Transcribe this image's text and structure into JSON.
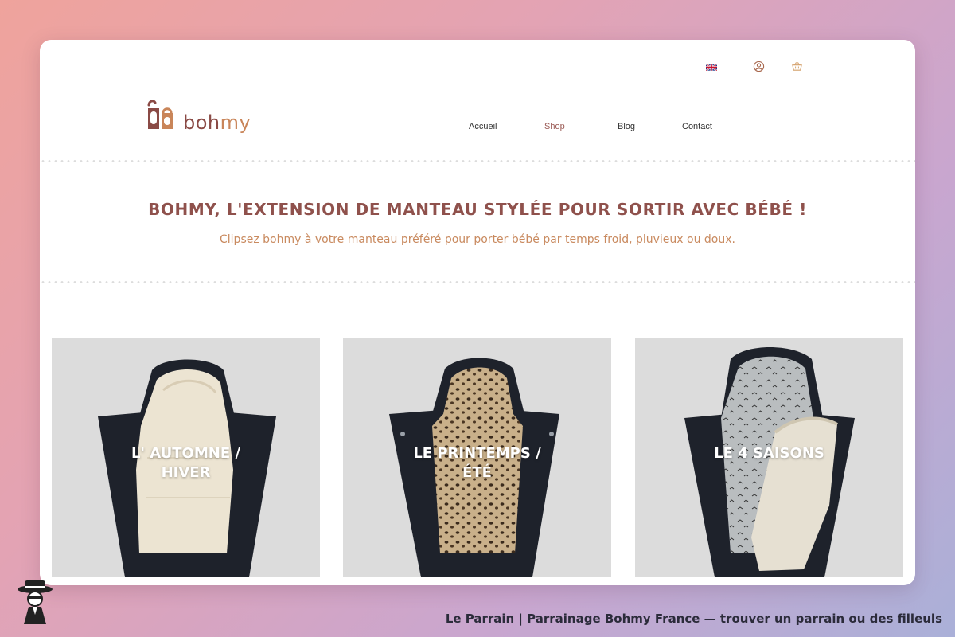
{
  "colors": {
    "brand_dark": "#8a4a45",
    "brand_light": "#c98559",
    "title": "#8f514c",
    "subtitle": "#c98a5f"
  },
  "topbar": {
    "language_icon": "uk-flag-icon",
    "account_icon": "user-circle-icon",
    "cart_icon": "basket-icon"
  },
  "logo": {
    "part1": "boh",
    "part2": "my"
  },
  "nav": {
    "items": [
      {
        "label": "Accueil"
      },
      {
        "label": "Shop"
      },
      {
        "label": "Blog"
      },
      {
        "label": "Contact"
      }
    ],
    "active": "Shop"
  },
  "hero": {
    "title": "BOHMY, L'EXTENSION DE MANTEAU STYLÉE POUR SORTIR AVEC BÉBÉ !",
    "subtitle": "Clipsez bohmy à votre manteau préféré pour porter bébé par temps froid, pluvieux ou doux."
  },
  "products": [
    {
      "title_line1": "L' AUTOMNE /",
      "title_line2": "HIVER"
    },
    {
      "title_line1": "LE PRINTEMPS /",
      "title_line2": "ÉTÉ"
    },
    {
      "title_line1": "LE 4 SAISONS",
      "title_line2": ""
    }
  ],
  "caption": "Le Parrain | Parrainage Bohmy France — trouver un parrain ou des filleuls"
}
